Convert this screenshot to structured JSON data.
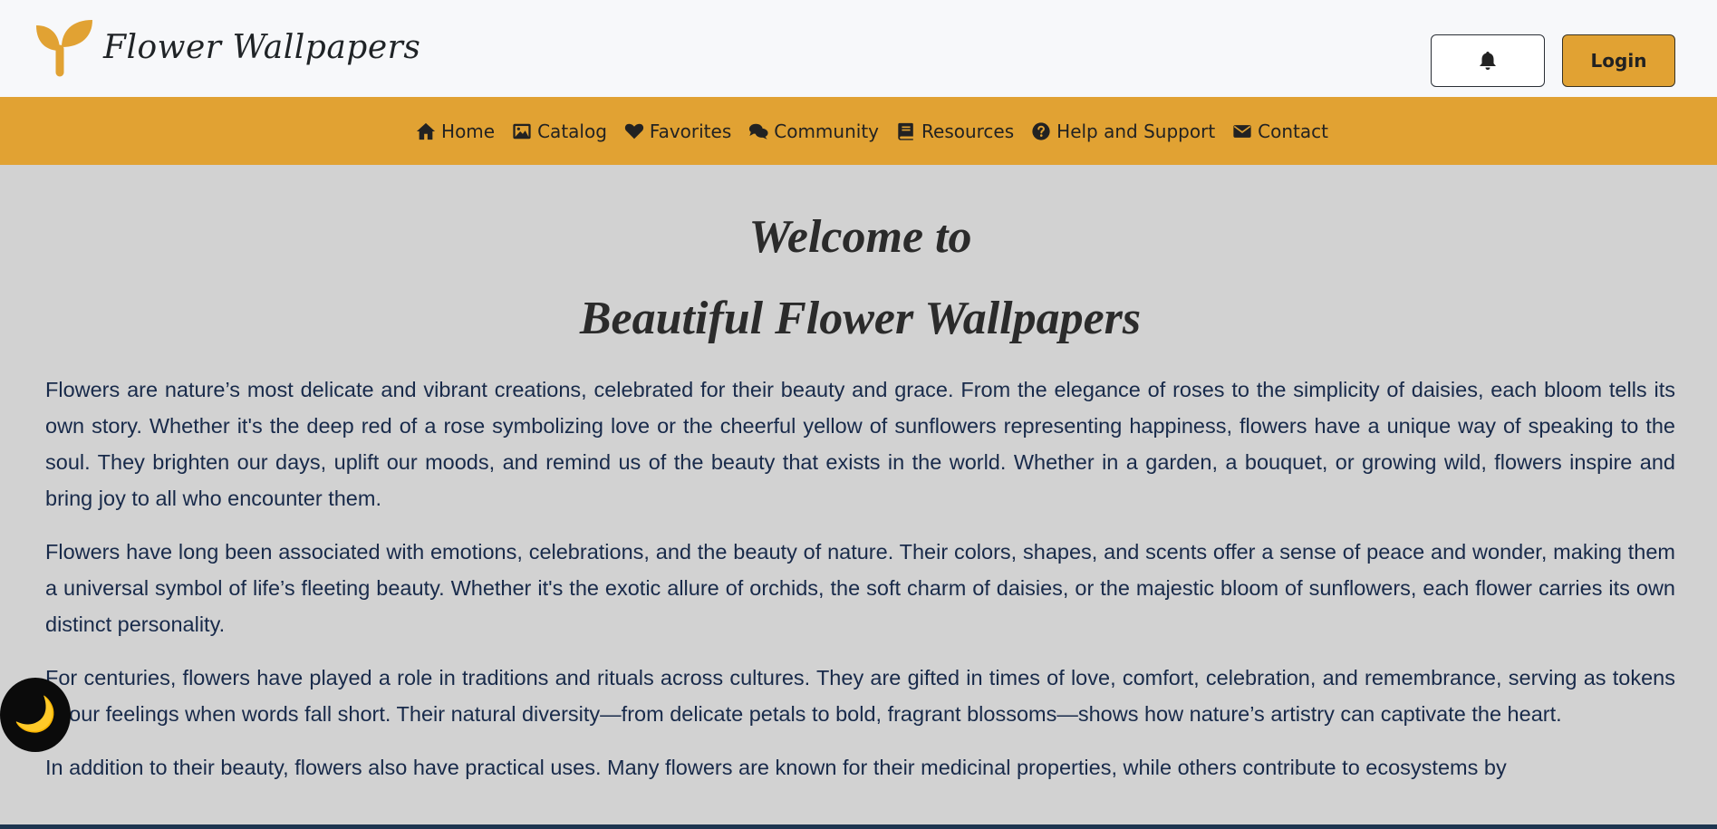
{
  "header": {
    "logo_text": "Flower Wallpapers",
    "login_label": "Login",
    "bell_icon": "bell-icon"
  },
  "nav": {
    "items": [
      {
        "label": "Home",
        "icon": "home-icon"
      },
      {
        "label": "Catalog",
        "icon": "image-icon"
      },
      {
        "label": "Favorites",
        "icon": "heart-icon"
      },
      {
        "label": "Community",
        "icon": "comments-icon"
      },
      {
        "label": "Resources",
        "icon": "book-icon"
      },
      {
        "label": "Help and Support",
        "icon": "question-circle-icon"
      },
      {
        "label": "Contact",
        "icon": "envelope-icon"
      }
    ]
  },
  "main": {
    "title_line1": "Welcome to",
    "title_line2": "Beautiful Flower Wallpapers",
    "paragraphs": [
      "Flowers are nature’s most delicate and vibrant creations, celebrated for their beauty and grace. From the elegance of roses to the simplicity of daisies, each bloom tells its own story. Whether it's the deep red of a rose symbolizing love or the cheerful yellow of sunflowers representing happiness, flowers have a unique way of speaking to the soul. They brighten our days, uplift our moods, and remind us of the beauty that exists in the world. Whether in a garden, a bouquet, or growing wild, flowers inspire and bring joy to all who encounter them.",
      "Flowers have long been associated with emotions, celebrations, and the beauty of nature. Their colors, shapes, and scents offer a sense of peace and wonder, making them a universal symbol of life’s fleeting beauty. Whether it's the exotic allure of orchids, the soft charm of daisies, or the majestic bloom of sunflowers, each flower carries its own distinct personality.",
      "For centuries, flowers have played a role in traditions and rituals across cultures. They are gifted in times of love, comfort, celebration, and remembrance, serving as tokens of our feelings when words fall short. Their natural diversity—from delicate petals to bold, fragrant blossoms—shows how nature’s artistry can captivate the heart.",
      "In addition to their beauty, flowers also have practical uses. Many flowers are known for their medicinal properties, while others contribute to ecosystems by"
    ]
  },
  "theme_toggle": {
    "icon": "moon-icon",
    "glyph": "🌙"
  },
  "colors": {
    "accent": "#e1a233",
    "background": "#d2d2d2",
    "header_bg": "#f7f8fa",
    "text": "#182a4a"
  }
}
